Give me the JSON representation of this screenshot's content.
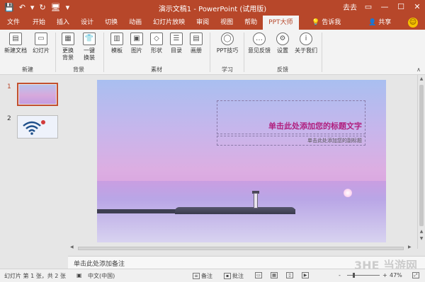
{
  "window": {
    "title": "演示文稿1 - PowerPoint (试用版)",
    "user": "去去",
    "controls": [
      "▭",
      "—",
      "☐",
      "✕"
    ]
  },
  "qat": [
    "💾",
    "↶",
    "▾",
    "↻",
    "🖥",
    "▾"
  ],
  "tabs": [
    {
      "label": "文件",
      "kind": "file"
    },
    {
      "label": "开始"
    },
    {
      "label": "插入"
    },
    {
      "label": "设计"
    },
    {
      "label": "切换"
    },
    {
      "label": "动画"
    },
    {
      "label": "幻灯片放映"
    },
    {
      "label": "审阅"
    },
    {
      "label": "视图"
    },
    {
      "label": "帮助"
    },
    {
      "label": "PPT大师",
      "active": true
    }
  ],
  "tell_me": "告诉我",
  "share": "共享",
  "ribbon": {
    "groups": {
      "new": "新建",
      "background": "背景",
      "material": "素材",
      "learn": "学习",
      "feedback": "反馈"
    },
    "buttons": {
      "new_doc": "新建文档",
      "slide": "幻灯片",
      "change_bg": "更换\n背景",
      "one_click": "一键\n换装",
      "template": "模板",
      "picture": "图片",
      "shape": "形状",
      "toc": "目录",
      "album": "画册",
      "ppt_tips": "PPT技巧",
      "feedback": "意见反馈",
      "settings": "设置",
      "about": "关于我们"
    }
  },
  "thumbnails": [
    "1",
    "2"
  ],
  "slide": {
    "title_placeholder": "单击此处添加您的标题文字",
    "subtitle_placeholder": "单击此处添加您的副标题"
  },
  "notes_placeholder": "单击此处添加备注",
  "status": {
    "slide_info": "幻灯片 第 1 张，共 2 张",
    "language": "中文(中国)",
    "notes": "备注",
    "comments": "批注",
    "zoom": "47%",
    "zoom_minus": "-",
    "zoom_plus": "+"
  },
  "watermark": "3HE 当游网",
  "colors": {
    "accent": "#b7472a",
    "title_text": "#b01e7e"
  }
}
